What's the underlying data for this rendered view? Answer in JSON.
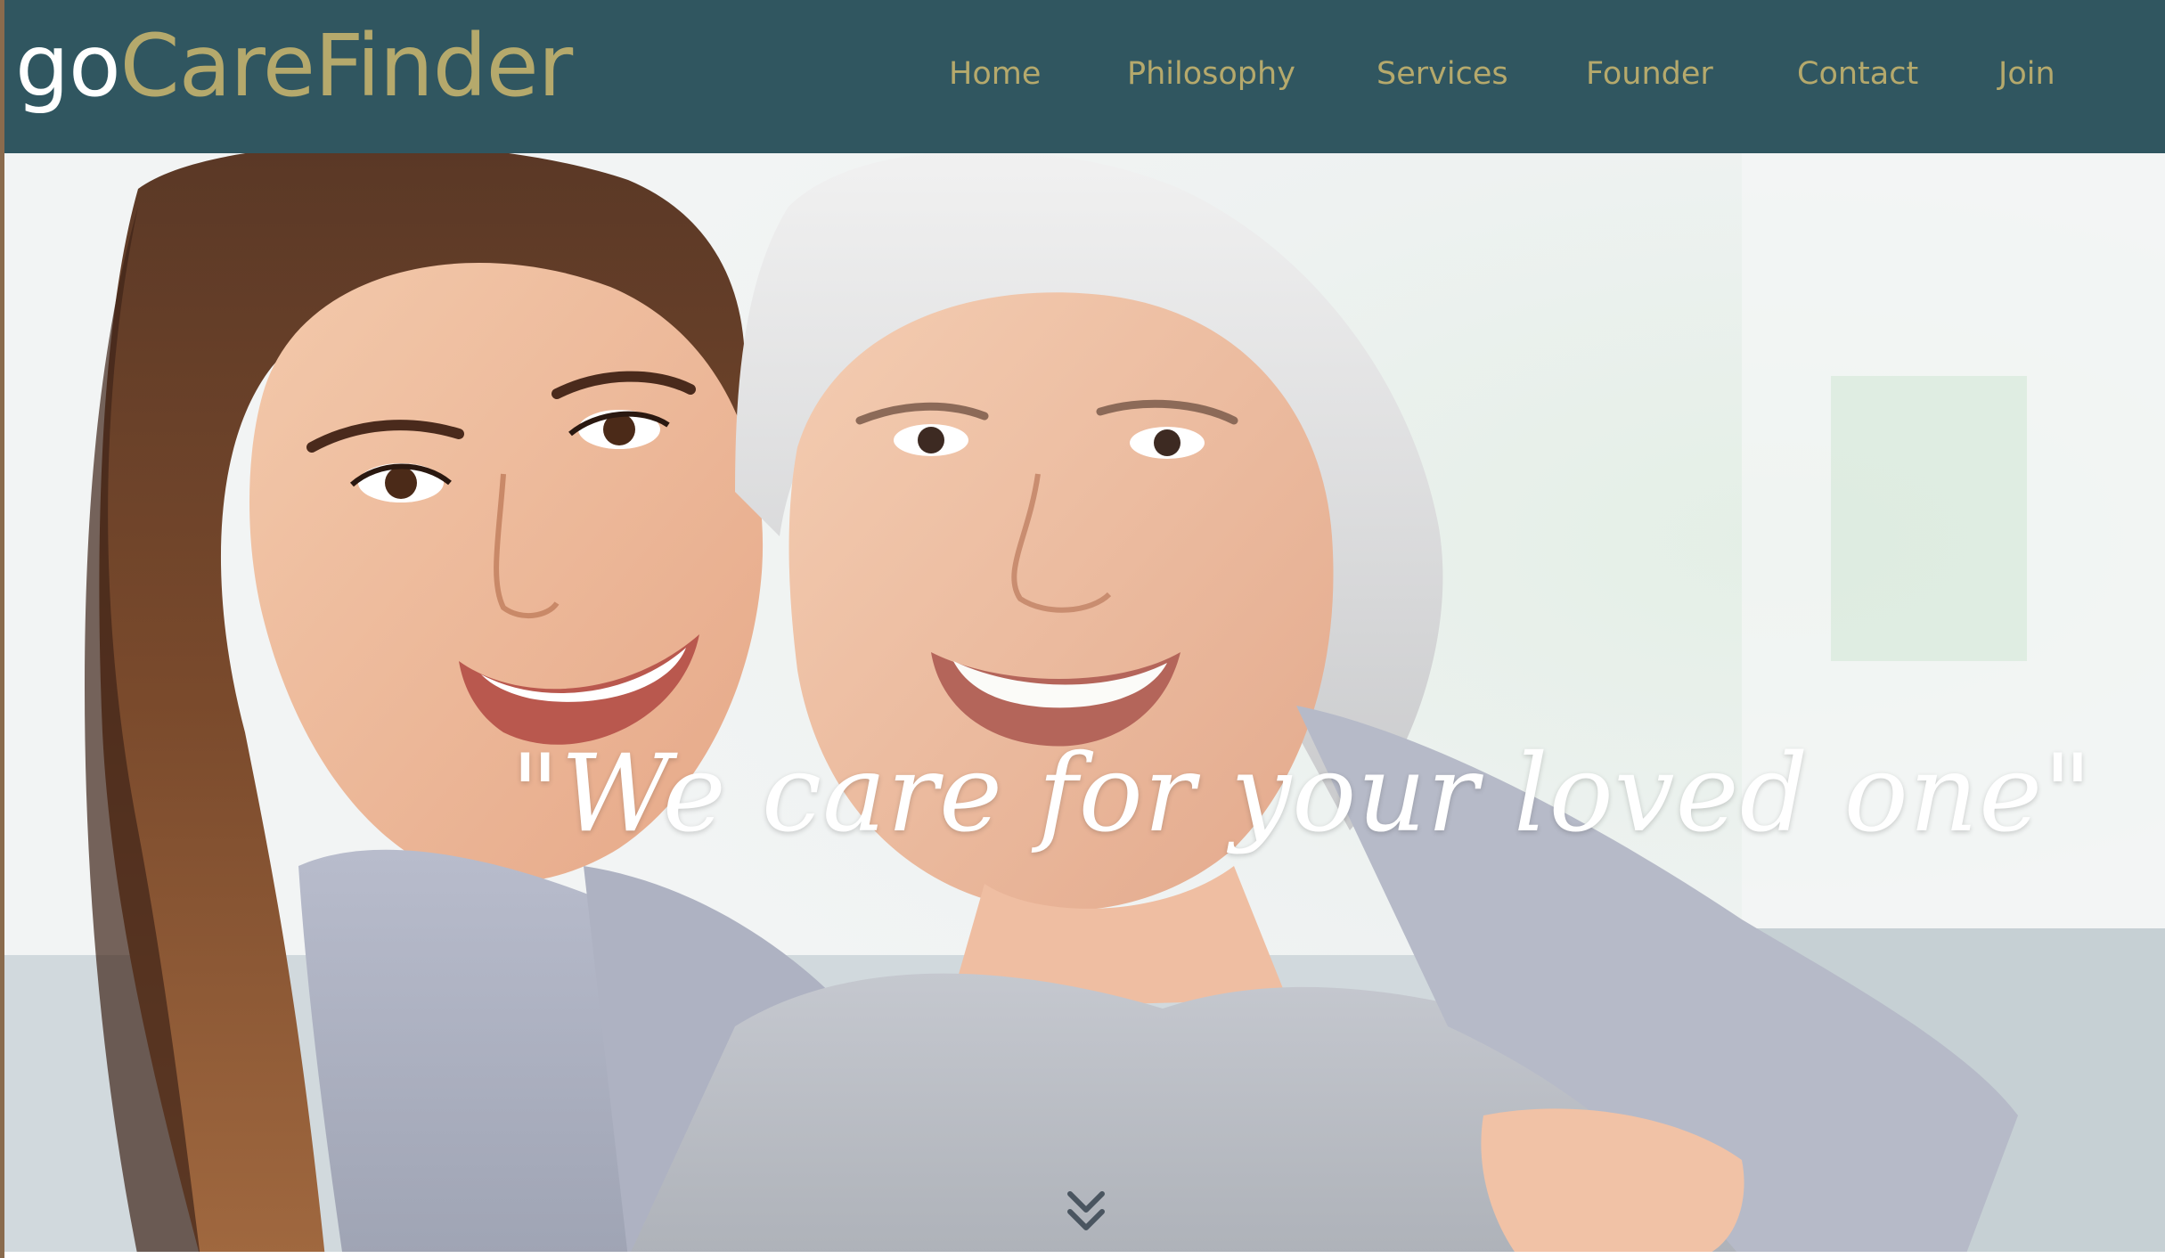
{
  "brand": {
    "prefix": "go",
    "name": "CareFinder"
  },
  "nav": {
    "items": [
      {
        "label": "Home"
      },
      {
        "label": "Philosophy"
      },
      {
        "label": "Services"
      },
      {
        "label": "Founder"
      },
      {
        "label": "Contact"
      },
      {
        "label": "Join"
      }
    ]
  },
  "hero": {
    "tagline": "\"We care for your loved one\"",
    "scroll_icon": "double-chevron-down-icon",
    "image": "photo of a smiling young woman hugging a smiling elderly woman"
  },
  "colors": {
    "header_bg": "#305660",
    "brand_accent": "#b5a96c",
    "nav_text": "#b5a96c",
    "logo_go": "#ffffff"
  }
}
